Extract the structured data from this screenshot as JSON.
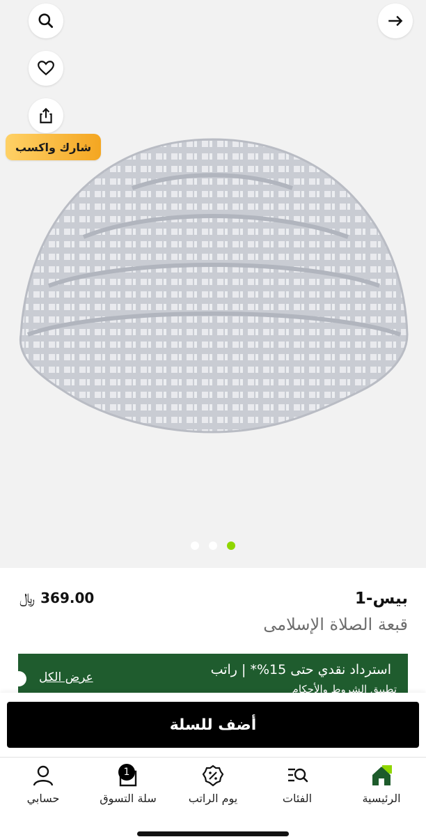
{
  "top": {
    "share_earn_label": "شارك واكسب"
  },
  "carousel": {
    "page_count": 3,
    "active_index": 2
  },
  "product": {
    "brand": "بيس-1",
    "title": "قبعة الصلاة الإسلامى",
    "price": "369.00",
    "currency_symbol": "﷼"
  },
  "cashback": {
    "text": "استرداد نقدي حتى 15%* | راتب",
    "terms": "تطبيق الشروط والأحكام",
    "view_all": "عرض الكل",
    "bg_color": "#1f5c2e"
  },
  "cart": {
    "add_to_cart": "أضف للسلة"
  },
  "tabbar": {
    "items": [
      {
        "label": "الرئيسية",
        "icon": "home-icon"
      },
      {
        "label": "الفئات",
        "icon": "categories-search-icon"
      },
      {
        "label": "يوم الراتب",
        "icon": "discount-badge-icon"
      },
      {
        "label": "سلة التسوق",
        "icon": "shopping-bag-icon",
        "badge": "1"
      },
      {
        "label": "حسابي",
        "icon": "user-icon"
      }
    ],
    "active_color": "#8fd600"
  }
}
